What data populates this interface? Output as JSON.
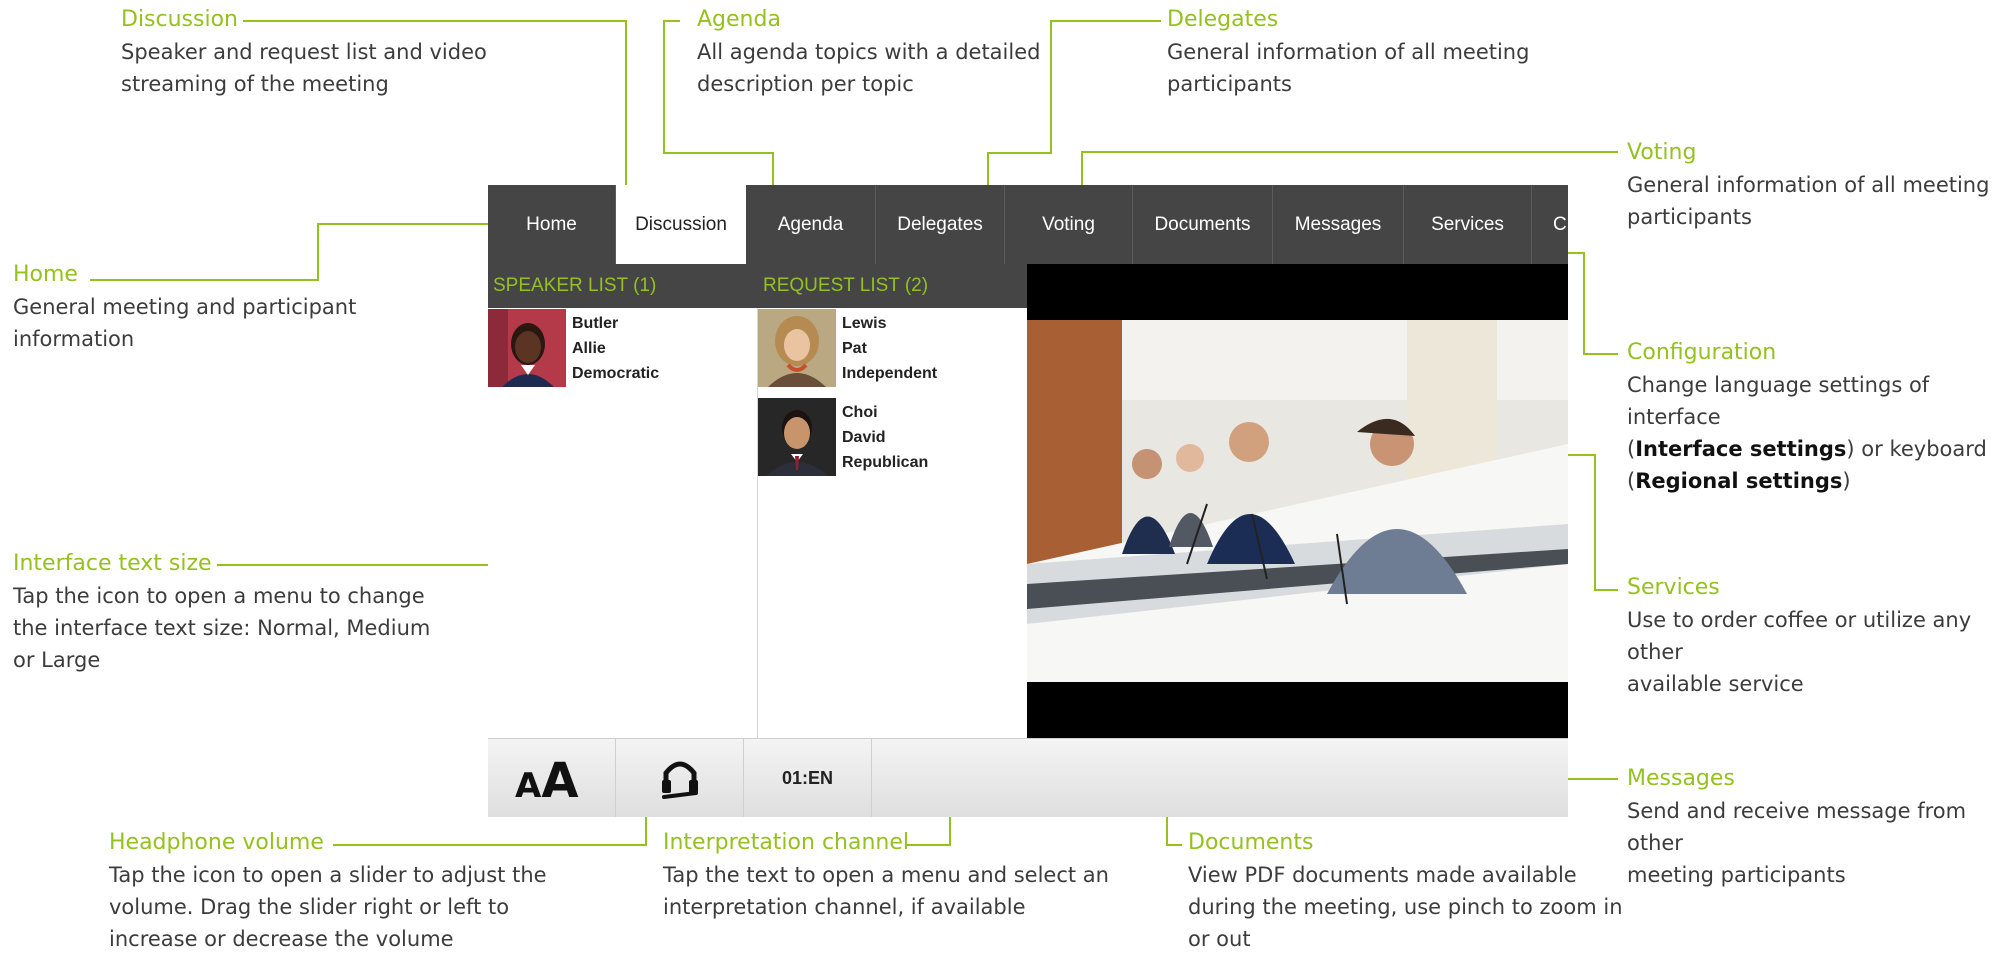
{
  "colors": {
    "accent": "#95c11f",
    "tab_bar": "#454545",
    "text": "#3c3c3c"
  },
  "annotations": {
    "discussion": {
      "title": "Discussion",
      "desc": [
        "Speaker and request list and video",
        "streaming of the meeting"
      ]
    },
    "agenda": {
      "title": "Agenda",
      "desc": [
        "All agenda topics with a detailed",
        "description per topic"
      ]
    },
    "delegates": {
      "title": "Delegates",
      "desc": [
        "General information of all meeting",
        "participants"
      ]
    },
    "voting": {
      "title": "Voting",
      "desc": [
        "General information of all meeting",
        "participants"
      ]
    },
    "home": {
      "title": "Home",
      "desc": [
        "General meeting and participant",
        "information"
      ]
    },
    "configuration": {
      "title": "Configuration",
      "desc_l1": "Change language settings of interface",
      "desc_l2_pre": "(",
      "desc_l2_bold": "Interface settings",
      "desc_l2_post": ") or keyboard",
      "desc_l3_pre": "(",
      "desc_l3_bold": "Regional settings",
      "desc_l3_post": ")"
    },
    "text_size": {
      "title": "Interface text size",
      "desc": [
        "Tap the icon to open a menu to change",
        "the interface text size: Normal, Medium",
        "or Large"
      ]
    },
    "services": {
      "title": "Services",
      "desc": [
        "Use to order coffee or utilize any other",
        "available service"
      ]
    },
    "messages": {
      "title": "Messages",
      "desc": [
        "Send and receive message from other",
        "meeting participants"
      ]
    },
    "headphone": {
      "title": "Headphone volume",
      "desc": [
        "Tap the icon to open a slider to adjust the",
        "volume. Drag the slider right or left to",
        "increase or decrease the volume"
      ]
    },
    "interpretation": {
      "title": "Interpretation channel",
      "desc": [
        "Tap the text to open a menu and select an",
        "interpretation channel, if available"
      ]
    },
    "documents": {
      "title": "Documents",
      "desc": [
        "View PDF documents made available",
        "during the meeting, use pinch to zoom in",
        "or out"
      ]
    }
  },
  "screen": {
    "tabs": [
      "Home",
      "Discussion",
      "Agenda",
      "Delegates",
      "Voting",
      "Documents",
      "Messages",
      "Services",
      "C"
    ],
    "active_tab": "Discussion",
    "speaker_list": {
      "header": "SPEAKER LIST (1)",
      "people": [
        {
          "last": "Butler",
          "first": "Allie",
          "party": "Democratic"
        }
      ]
    },
    "request_list": {
      "header": "REQUEST LIST (2)",
      "people": [
        {
          "last": "Lewis",
          "first": "Pat",
          "party": "Independent"
        },
        {
          "last": "Choi",
          "first": "David",
          "party": "Republican"
        }
      ]
    },
    "footer": {
      "text_size_icon": "text-size-icon",
      "headphone_icon": "headphone-icon",
      "channel": "01:EN"
    }
  }
}
